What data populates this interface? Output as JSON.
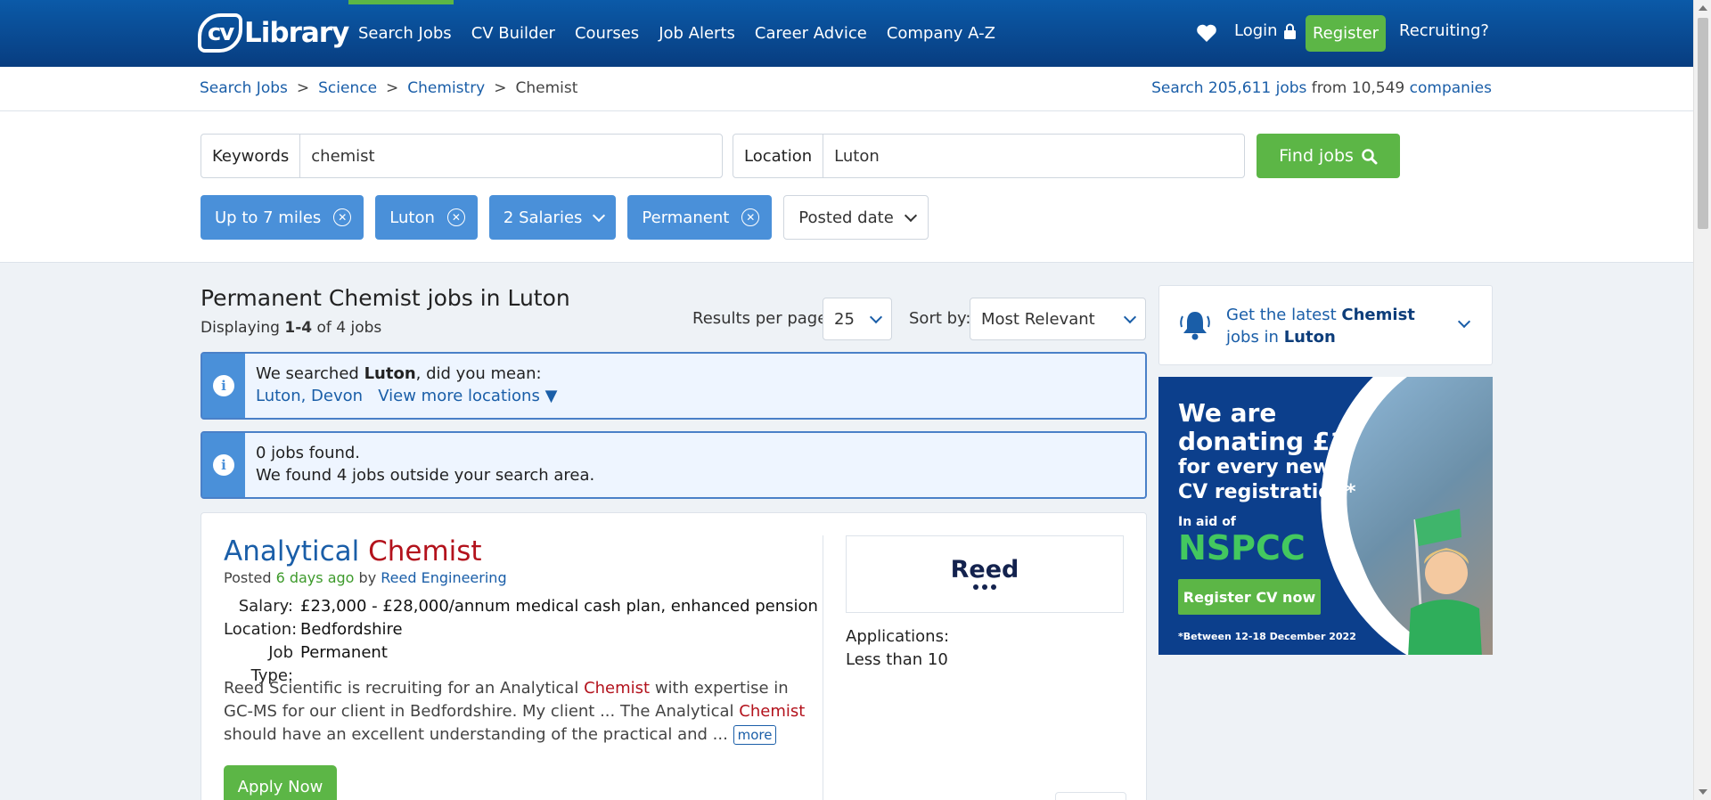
{
  "nav": {
    "logo_cv": "cv",
    "logo_library": "Library",
    "links": [
      "Search Jobs",
      "CV Builder",
      "Courses",
      "Job Alerts",
      "Career Advice",
      "Company A-Z"
    ],
    "login": "Login",
    "register": "Register",
    "recruiting": "Recruiting?"
  },
  "breadcrumb": {
    "items": [
      "Search Jobs",
      "Science",
      "Chemistry",
      "Chemist"
    ],
    "separator": ">"
  },
  "stats": {
    "prefix": "Search",
    "jobs": "205,611 jobs",
    "middle": "from 10,549",
    "companies": "companies"
  },
  "search": {
    "keywords_label": "Keywords",
    "keywords_value": "chemist",
    "location_label": "Location",
    "location_value": "Luton",
    "find_label": "Find jobs"
  },
  "filters": {
    "distance": "Up to 7 miles",
    "location": "Luton",
    "salaries": "2 Salaries",
    "type": "Permanent",
    "posted": "Posted date"
  },
  "results": {
    "title": "Permanent Chemist jobs in Luton",
    "displaying_prefix": "Displaying",
    "displaying_range": "1-4",
    "displaying_suffix": "of 4 jobs",
    "per_page_label": "Results per page:",
    "per_page_value": "25",
    "sort_label": "Sort by:",
    "sort_value": "Most Relevant"
  },
  "info1": {
    "prefix": "We searched",
    "place": "Luton",
    "suffix": ", did you mean:",
    "suggestion": "Luton, Devon",
    "more_locations": "View more locations"
  },
  "info2": {
    "line1": "0 jobs found.",
    "line2": "We found 4 jobs outside your search area."
  },
  "job": {
    "title_part1": "Analytical",
    "title_part2": "Chemist",
    "posted_prefix": "Posted",
    "posted_ago": "6 days ago",
    "posted_by": "by",
    "company": "Reed Engineering",
    "salary_label": "Salary:",
    "salary": "£23,000 - £28,000/annum medical cash plan, enhanced pension",
    "location_label": "Location:",
    "location": "Bedfordshire",
    "type_label": "Job Type:",
    "type": "Permanent",
    "desc_1": "Reed Scientific is recruiting for an Analytical ",
    "desc_hl1": "Chemist",
    "desc_2": " with expertise in GC-MS for our client in Bedfordshire. My client ... The Analytical ",
    "desc_hl2": "Chemist",
    "desc_3": " should have an excellent understanding of the practical and ... ",
    "more": "more",
    "apply": "Apply Now",
    "logo_text": "Reed",
    "applications_label": "Applications:",
    "applications_value": "Less than 10"
  },
  "alert": {
    "prefix": "Get the latest",
    "keyword": "Chemist",
    "middle": "jobs in",
    "location": "Luton"
  },
  "ad": {
    "headline1": "We are",
    "headline2": "donating £1",
    "sub": "for every new CV registration*",
    "aid": "In aid of",
    "charity": "NSPCC",
    "button": "Register CV now",
    "footnote": "*Between 12-18 December 2022"
  },
  "colors": {
    "brand_blue": "#0b5aa8",
    "accent_green": "#5cb646",
    "chip_blue": "#4a90d9",
    "highlight_red": "#b3121c"
  }
}
